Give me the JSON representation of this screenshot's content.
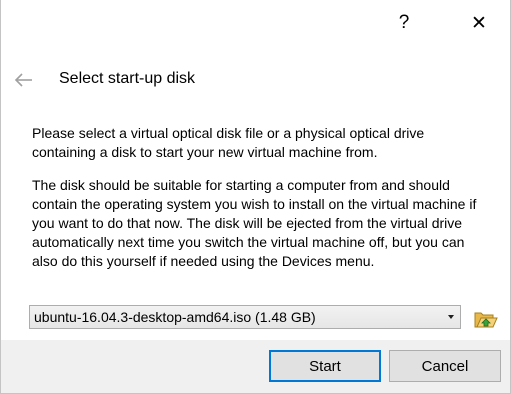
{
  "titlebar": {
    "help_label": "?",
    "close_label": "✕"
  },
  "header": {
    "back_icon": "back-arrow-icon",
    "title": "Select start-up disk"
  },
  "body": {
    "paragraph1": "Please select a virtual optical disk file or a physical optical drive containing a disk to start your new virtual machine from.",
    "paragraph2": "The disk should be suitable for starting a computer from and should contain the operating system you wish to install on the virtual machine if you want to do that now. The disk will be ejected from the virtual drive automatically next time you switch the virtual machine off, but you can also do this yourself if needed using the Devices menu."
  },
  "disk_selector": {
    "selected_value": "ubuntu-16.04.3-desktop-amd64.iso (1.48 GB)",
    "browse_icon": "folder-open-icon"
  },
  "buttons": {
    "start_label": "Start",
    "cancel_label": "Cancel"
  },
  "colors": {
    "accent": "#0078d7",
    "button_bar": "#f0f0f0",
    "button_face": "#e1e1e1"
  }
}
